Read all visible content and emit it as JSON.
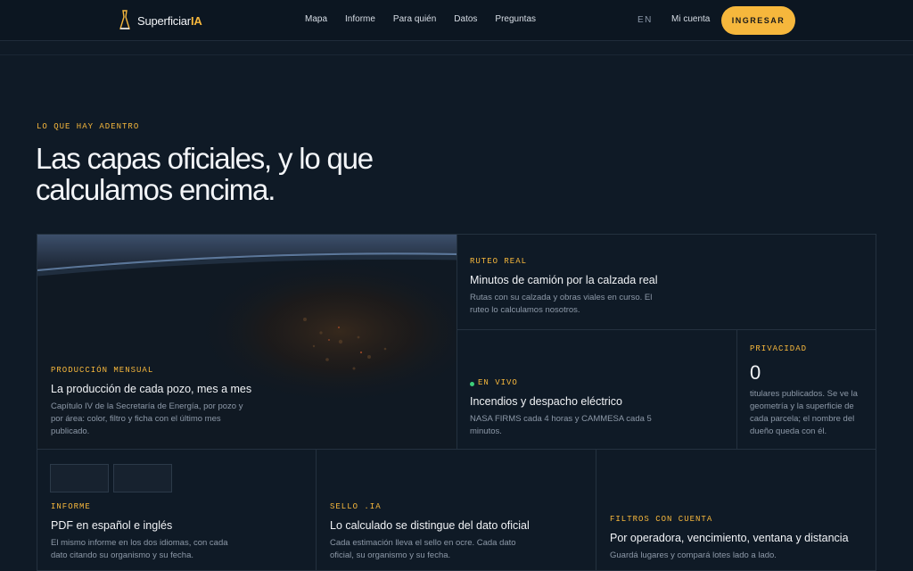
{
  "nav": {
    "brand_main": "Superficiar",
    "brand_suffix": "IA",
    "links": [
      "Mapa",
      "Informe",
      "Para quién",
      "Datos",
      "Preguntas"
    ],
    "lang": "EN",
    "account": "Mi cuenta",
    "cta": "INGRESAR"
  },
  "section": {
    "eyebrow": "LO QUE HAY ADENTRO",
    "headline": "Las capas oficiales, y lo que calculamos encima."
  },
  "cards": {
    "produccion": {
      "label": "PRODUCCIÓN MENSUAL",
      "title": "La producción de cada pozo, mes a mes",
      "desc": "Capítulo IV de la Secretaría de Energía, por pozo y por área: color, filtro y ficha con el último mes publicado."
    },
    "ruteo": {
      "label": "RUTEO REAL",
      "title": "Minutos de camión por la calzada real",
      "desc": "Rutas con su calzada y obras viales en curso. El ruteo lo calculamos nosotros."
    },
    "fuego": {
      "label": "EN VIVO",
      "title": "Incendios y despacho eléctrico",
      "desc": "NASA FIRMS cada 4 horas y CAMMESA cada 5 minutos."
    },
    "privacidad": {
      "label": "PRIVACIDAD",
      "value": "0",
      "desc": "titulares publicados. Se ve la geometría y la superficie de cada parcela; el nombre del dueño queda con él."
    },
    "informe": {
      "label": "INFORME",
      "title": "PDF en español e inglés",
      "desc": "El mismo informe en los dos idiomas, con cada dato citando su organismo y su fecha."
    },
    "sello": {
      "label": "SELLO .IA",
      "title": "Lo calculado se distingue del dato oficial",
      "desc": "Cada estimación lleva el sello en ocre. Cada dato oficial, su organismo y su fecha."
    },
    "filtros": {
      "label": "FILTROS CON CUENTA",
      "title": "Por operadora, vencimiento, ventana y distancia",
      "desc": "Guardá lugares y compará lotes lado a lado."
    }
  },
  "colors": {
    "background": "#0f1a26",
    "accent": "#f6b73c",
    "live": "#3ccf7a"
  },
  "icons": {
    "logo": "pick-mark-icon",
    "live": "live-dot-icon"
  }
}
